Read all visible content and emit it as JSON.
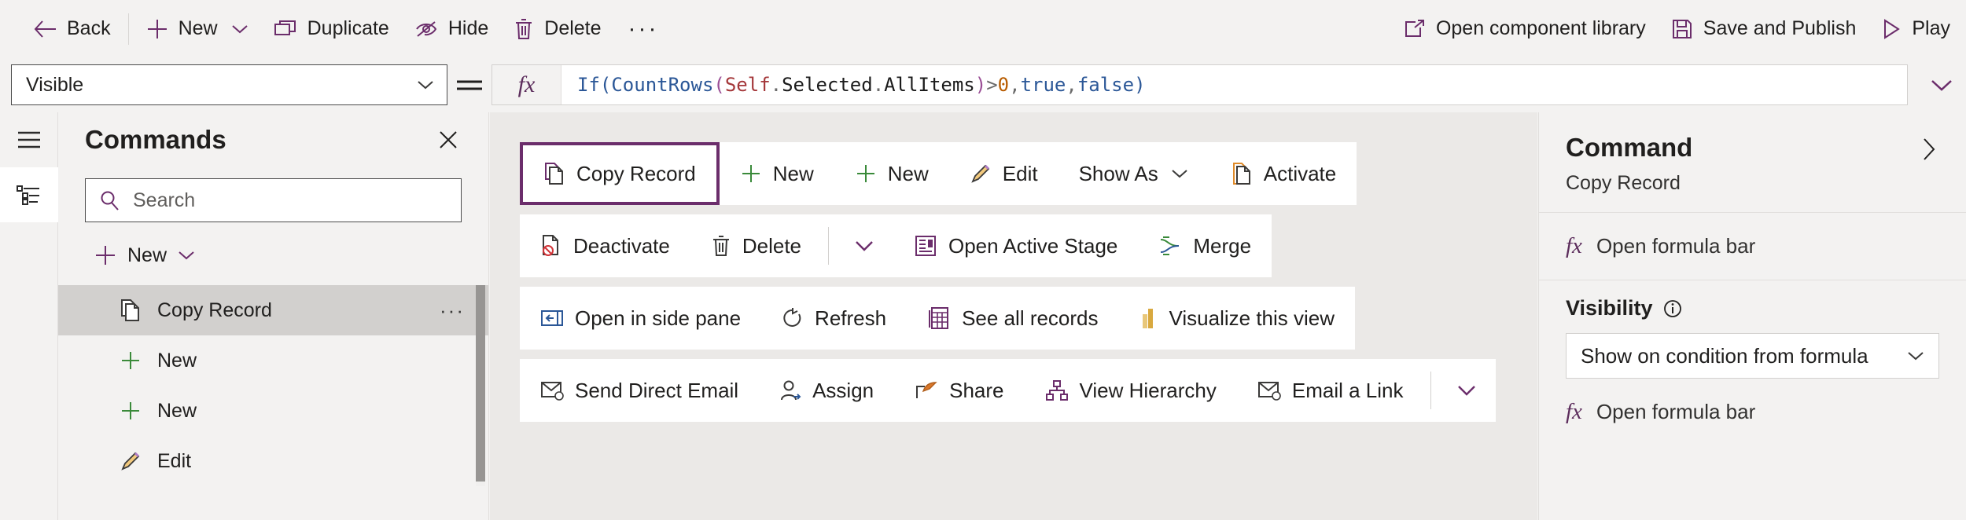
{
  "topbar": {
    "left_buttons": [
      {
        "label": "Back",
        "icon": "back-arrow-icon",
        "has_chevron": false
      },
      {
        "label": "New",
        "icon": "plus-icon",
        "has_chevron": true
      },
      {
        "label": "Duplicate",
        "icon": "duplicate-icon",
        "has_chevron": false
      },
      {
        "label": "Hide",
        "icon": "hide-eye-icon",
        "has_chevron": false
      },
      {
        "label": "Delete",
        "icon": "trash-icon",
        "has_chevron": false
      }
    ],
    "overflow_label": "···",
    "right_buttons": [
      {
        "label": "Open component library",
        "icon": "open-external-icon"
      },
      {
        "label": "Save and Publish",
        "icon": "save-disk-icon"
      },
      {
        "label": "Play",
        "icon": "play-triangle-icon"
      }
    ]
  },
  "formula_bar": {
    "property_selected": "Visible",
    "equals": "=",
    "fx_label": "fx",
    "formula_tokens": [
      {
        "t": "If",
        "c": "t-fn"
      },
      {
        "t": "(",
        "c": "t-par1"
      },
      {
        "t": "CountRows",
        "c": "t-fn"
      },
      {
        "t": "(",
        "c": "t-par2"
      },
      {
        "t": "Self",
        "c": "t-self"
      },
      {
        "t": ".",
        "c": "t-op"
      },
      {
        "t": "Selected",
        "c": "t-id"
      },
      {
        "t": ".",
        "c": "t-op"
      },
      {
        "t": "AllItems",
        "c": "t-id"
      },
      {
        "t": ")",
        "c": "t-par2"
      },
      {
        "t": ">",
        "c": "t-op"
      },
      {
        "t": "0",
        "c": "t-num"
      },
      {
        "t": ",",
        "c": "t-op"
      },
      {
        "t": "true",
        "c": "t-bool"
      },
      {
        "t": ",",
        "c": "t-op"
      },
      {
        "t": "false",
        "c": "t-bool"
      },
      {
        "t": ")",
        "c": "t-par1"
      }
    ],
    "formula_plain": "If(CountRows(Self.Selected.AllItems)>0,true,false)"
  },
  "left_rail": {
    "items": [
      {
        "name": "hamburger-menu-icon",
        "active": false
      },
      {
        "name": "tree-view-icon",
        "active": true
      }
    ]
  },
  "commands_panel": {
    "title": "Commands",
    "close_label": "×",
    "search_placeholder": "Search",
    "search_value": "",
    "new_label": "New",
    "items": [
      {
        "label": "Copy Record",
        "icon": "copy-record-icon",
        "selected": true,
        "more": "···"
      },
      {
        "label": "New",
        "icon": "plus-green-icon",
        "selected": false,
        "more": ""
      },
      {
        "label": "New",
        "icon": "plus-green-icon",
        "selected": false,
        "more": ""
      },
      {
        "label": "Edit",
        "icon": "pencil-icon",
        "selected": false,
        "more": ""
      }
    ]
  },
  "canvas": {
    "rows": [
      {
        "items": [
          {
            "type": "button",
            "label": "Copy Record",
            "icon": "copy-record-icon",
            "selected": true
          },
          {
            "type": "button",
            "label": "New",
            "icon": "plus-green-icon",
            "selected": false
          },
          {
            "type": "button",
            "label": "New",
            "icon": "plus-green-icon",
            "selected": false
          },
          {
            "type": "button",
            "label": "Edit",
            "icon": "pencil-icon",
            "selected": false
          },
          {
            "type": "button",
            "label": "Show As",
            "icon": "",
            "selected": false,
            "has_chevron": true
          },
          {
            "type": "button",
            "label": "Activate",
            "icon": "activate-page-icon",
            "selected": false
          }
        ]
      },
      {
        "items": [
          {
            "type": "button",
            "label": "Deactivate",
            "icon": "deactivate-icon",
            "selected": false
          },
          {
            "type": "button",
            "label": "Delete",
            "icon": "trash-icon",
            "selected": false
          },
          {
            "type": "divider"
          },
          {
            "type": "chevron",
            "label": "",
            "icon": "chevron-down-icon"
          },
          {
            "type": "button",
            "label": "Open Active Stage",
            "icon": "open-active-stage-icon",
            "selected": false
          },
          {
            "type": "button",
            "label": "Merge",
            "icon": "merge-icon",
            "selected": false
          }
        ]
      },
      {
        "items": [
          {
            "type": "button",
            "label": "Open in side pane",
            "icon": "side-pane-icon",
            "selected": false
          },
          {
            "type": "button",
            "label": "Refresh",
            "icon": "refresh-icon",
            "selected": false
          },
          {
            "type": "button",
            "label": "See all records",
            "icon": "see-all-records-icon",
            "selected": false
          },
          {
            "type": "button",
            "label": "Visualize this view",
            "icon": "visualize-chart-icon",
            "selected": false
          }
        ]
      },
      {
        "items": [
          {
            "type": "button",
            "label": "Send Direct Email",
            "icon": "email-icon",
            "selected": false
          },
          {
            "type": "button",
            "label": "Assign",
            "icon": "assign-person-icon",
            "selected": false
          },
          {
            "type": "button",
            "label": "Share",
            "icon": "share-icon",
            "selected": false
          },
          {
            "type": "button",
            "label": "View Hierarchy",
            "icon": "hierarchy-icon",
            "selected": false
          },
          {
            "type": "button",
            "label": "Email a Link",
            "icon": "email-icon",
            "selected": false
          },
          {
            "type": "divider"
          },
          {
            "type": "chevron",
            "label": "",
            "icon": "chevron-down-icon"
          }
        ]
      }
    ]
  },
  "right_panel": {
    "title": "Command",
    "subtitle": "Copy Record",
    "action_fx_label": "Open formula bar",
    "visibility_label": "Visibility",
    "visibility_info_icon": "info-icon",
    "visibility_value": "Show on condition from formula",
    "visibility_fx_label": "Open formula bar",
    "fx_label": "fx"
  },
  "colors": {
    "accent_purple": "#6b2d6b",
    "app_background": "#f3f2f1",
    "canvas_background": "#ebe9e7",
    "selection_grey": "#d2d0ce",
    "green_plus": "#3a8a3a",
    "blue": "#2b5797"
  }
}
